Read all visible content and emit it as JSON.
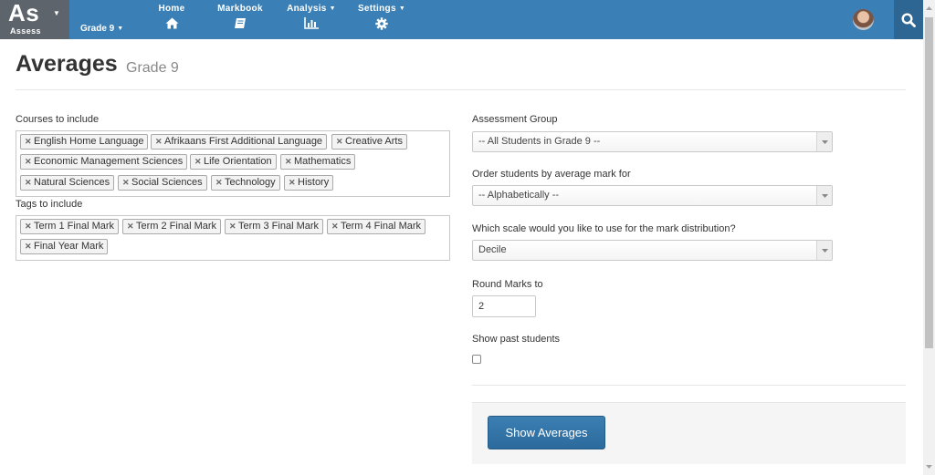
{
  "brand": {
    "big": "As",
    "small": "Assess"
  },
  "nav": {
    "grade": "Grade 9",
    "items": [
      {
        "label": "Home",
        "icon": "home-icon",
        "dropdown": false
      },
      {
        "label": "Markbook",
        "icon": "book-icon",
        "dropdown": false
      },
      {
        "label": "Analysis",
        "icon": "bar-chart-icon",
        "dropdown": true
      },
      {
        "label": "Settings",
        "icon": "gear-icon",
        "dropdown": true
      }
    ]
  },
  "page": {
    "title": "Averages",
    "subtitle": "Grade 9"
  },
  "courses": {
    "label": "Courses to include",
    "tags": [
      "English Home Language",
      "Afrikaans First Additional Language",
      "Creative Arts",
      "Economic Management Sciences",
      "Life Orientation",
      "Mathematics",
      "Natural Sciences",
      "Social Sciences",
      "Technology",
      "History"
    ]
  },
  "tags": {
    "label": "Tags to include",
    "tags": [
      "Term 1 Final Mark",
      "Term 2 Final Mark",
      "Term 3 Final Mark",
      "Term 4 Final Mark",
      "Final Year Mark"
    ]
  },
  "assessment_group": {
    "label": "Assessment Group",
    "value": "-- All Students in Grade 9 --"
  },
  "order_by": {
    "label": "Order students by average mark for",
    "value": "-- Alphabetically --"
  },
  "scale": {
    "label": "Which scale would you like to use for the mark distribution?",
    "value": "Decile"
  },
  "round_marks": {
    "label": "Round Marks to",
    "value": "2"
  },
  "show_past": {
    "label": "Show past students",
    "checked": false
  },
  "submit": {
    "label": "Show Averages"
  },
  "colors": {
    "navbar": "#3a7fb5",
    "brand_bg": "#5e646c",
    "search_bg": "#2d6593",
    "button": "#2f6fa1"
  }
}
